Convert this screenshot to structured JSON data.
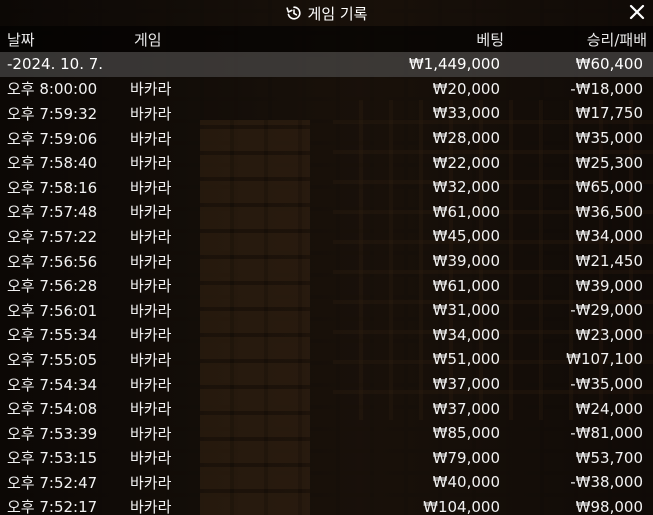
{
  "window": {
    "title": "게임 기록",
    "close_icon": "close-icon",
    "history_icon": "history-icon"
  },
  "columns": {
    "date": "날짜",
    "game": "게임",
    "bet": "베팅",
    "result": "승리/패배"
  },
  "summary": {
    "date": "-2024. 10. 7.",
    "bet": "₩1,449,000",
    "result": "₩60,400"
  },
  "rows": [
    {
      "time": "오후 8:00:00",
      "game": "바카라",
      "bet": "₩20,000",
      "result": "-₩18,000"
    },
    {
      "time": "오후 7:59:32",
      "game": "바카라",
      "bet": "₩33,000",
      "result": "₩17,750"
    },
    {
      "time": "오후 7:59:06",
      "game": "바카라",
      "bet": "₩28,000",
      "result": "₩35,000"
    },
    {
      "time": "오후 7:58:40",
      "game": "바카라",
      "bet": "₩22,000",
      "result": "₩25,300"
    },
    {
      "time": "오후 7:58:16",
      "game": "바카라",
      "bet": "₩32,000",
      "result": "₩65,000"
    },
    {
      "time": "오후 7:57:48",
      "game": "바카라",
      "bet": "₩61,000",
      "result": "₩36,500"
    },
    {
      "time": "오후 7:57:22",
      "game": "바카라",
      "bet": "₩45,000",
      "result": "₩34,000"
    },
    {
      "time": "오후 7:56:56",
      "game": "바카라",
      "bet": "₩39,000",
      "result": "₩21,450"
    },
    {
      "time": "오후 7:56:28",
      "game": "바카라",
      "bet": "₩61,000",
      "result": "₩39,000"
    },
    {
      "time": "오후 7:56:01",
      "game": "바카라",
      "bet": "₩31,000",
      "result": "-₩29,000"
    },
    {
      "time": "오후 7:55:34",
      "game": "바카라",
      "bet": "₩34,000",
      "result": "₩23,000"
    },
    {
      "time": "오후 7:55:05",
      "game": "바카라",
      "bet": "₩51,000",
      "result": "₩107,100"
    },
    {
      "time": "오후 7:54:34",
      "game": "바카라",
      "bet": "₩37,000",
      "result": "-₩35,000"
    },
    {
      "time": "오후 7:54:08",
      "game": "바카라",
      "bet": "₩37,000",
      "result": "₩24,000"
    },
    {
      "time": "오후 7:53:39",
      "game": "바카라",
      "bet": "₩85,000",
      "result": "-₩81,000"
    },
    {
      "time": "오후 7:53:15",
      "game": "바카라",
      "bet": "₩79,000",
      "result": "₩53,700"
    },
    {
      "time": "오후 7:52:47",
      "game": "바카라",
      "bet": "₩40,000",
      "result": "-₩38,000"
    },
    {
      "time": "오후 7:52:17",
      "game": "바카라",
      "bet": "₩104,000",
      "result": "₩98,000"
    }
  ]
}
